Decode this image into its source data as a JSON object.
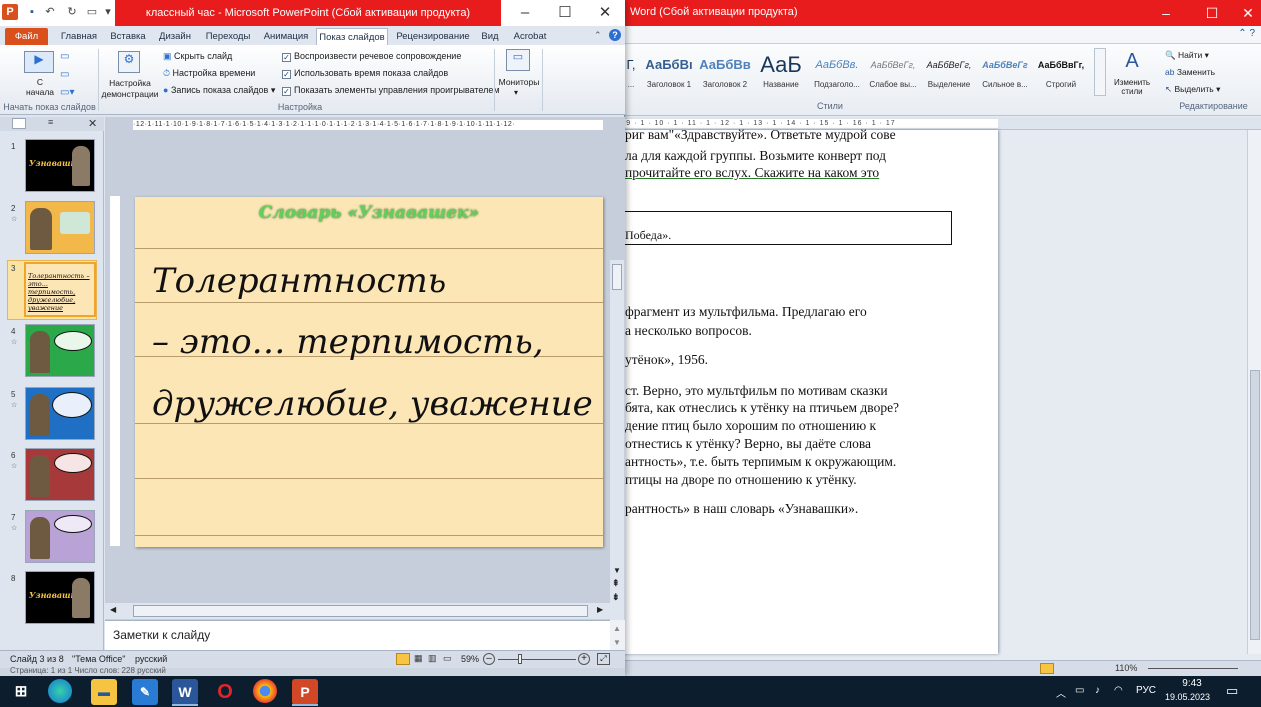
{
  "word": {
    "title": "Word (Сбой активации продукта)",
    "styles": [
      {
        "sample": "Г,",
        "name": "..."
      },
      {
        "sample": "АаБбВı",
        "name": "Заголовок 1"
      },
      {
        "sample": "АаБбВв",
        "name": "Заголовок 2"
      },
      {
        "sample": "АаБ",
        "name": "Название"
      },
      {
        "sample": "АаБбВв.",
        "name": "Подзаголо..."
      },
      {
        "sample": "АаБбВеГг,",
        "name": "Слабое вы..."
      },
      {
        "sample": "АаБбВеГг,",
        "name": "Выделение"
      },
      {
        "sample": "АаБбВеГг",
        "name": "Сильное в..."
      },
      {
        "sample": "АаБбВвГг,",
        "name": "Строгий"
      }
    ],
    "change_styles": "Изменить стили",
    "styles_group": "Стили",
    "find": "Найти",
    "replace": "Заменить",
    "select": "Выделить",
    "editing_group": "Редактирование",
    "doc_lines": [
      "риг вам\"«Здравствуйте». Ответьте мудрой сове",
      "ла для каждой группы. Возьмите конверт под",
      "прочитайте его вслух. Скажите на каком это",
      "Победа».",
      "фрагмент из мультфильма. Предлагаю его",
      "а несколько вопросов.",
      "утёнок», 1956.",
      "ст. Верно, это мультфильм по мотивам сказки",
      "бята, как отнеслись к утёнку на птичьем дворе?",
      "дение птиц было хорошим по отношению к",
      "отнестись к утёнку? Верно, вы даёте слова",
      "антность», т.е. быть терпимым к окружающим.",
      "птицы на дворе по отношению к утёнку.",
      "рантность» в наш словарь «Узнавашки»."
    ],
    "zoom": "110%"
  },
  "ppt": {
    "title": "классный час - Microsoft PowerPoint (Сбой активации продукта)",
    "tabs": [
      "Файл",
      "Главная",
      "Вставка",
      "Дизайн",
      "Переходы",
      "Анимация",
      "Показ слайдов",
      "Рецензирование",
      "Вид",
      "Acrobat"
    ],
    "ribbon": {
      "from_start": "С начала",
      "start_group": "Начать показ слайдов",
      "setup_show": "Настройка демонстрации",
      "hide_slide": "Скрыть слайд",
      "rehearse": "Настройка времени",
      "record": "Запись показа слайдов",
      "play_narrations": "Воспроизвести речевое сопровождение",
      "use_timings": "Использовать время показа слайдов",
      "show_controls": "Показать элементы управления проигрывателем",
      "setup_group": "Настройка",
      "monitors": "Мониторы"
    },
    "thumbs": [
      {
        "num": "1",
        "bg": "#000000",
        "text": "Узнавашки"
      },
      {
        "num": "2",
        "bg": "#f3b84a",
        "text": ""
      },
      {
        "num": "3",
        "bg": "#fde6b6",
        "text": "Толерантность – это... терпимость, дружелюбие, уважение"
      },
      {
        "num": "4",
        "bg": "#2aa84a",
        "text": ""
      },
      {
        "num": "5",
        "bg": "#1f6fc4",
        "text": ""
      },
      {
        "num": "6",
        "bg": "#a8393a",
        "text": ""
      },
      {
        "num": "7",
        "bg": "#b9a2d6",
        "text": ""
      },
      {
        "num": "8",
        "bg": "#000000",
        "text": "Узнавашки"
      }
    ],
    "ruler": "·12·1·11·1·10·1·9·1·8·1·7·1·6·1·5·1·4·1·3·1·2·1·1·1·0·1·1·1·2·1·3·1·4·1·5·1·6·1·7·1·8·1·9·1·10·1·11·1·12·",
    "slide": {
      "title": "Словарь «Узнавашек»",
      "lines": [
        "Толерантность",
        "– это… терпимость,",
        "дружелюбие, уважение"
      ]
    },
    "notes_placeholder": "Заметки к слайду",
    "status": {
      "slide": "Слайд 3 из 8",
      "theme": "\"Тема Office\"",
      "lang": "русский",
      "zoom": "59%",
      "word_status": "Страница: 1 из 1   Число слов: 228   русский"
    }
  },
  "taskbar": {
    "lang": "РУС",
    "time": "9:43",
    "date": "19.05.2023"
  }
}
